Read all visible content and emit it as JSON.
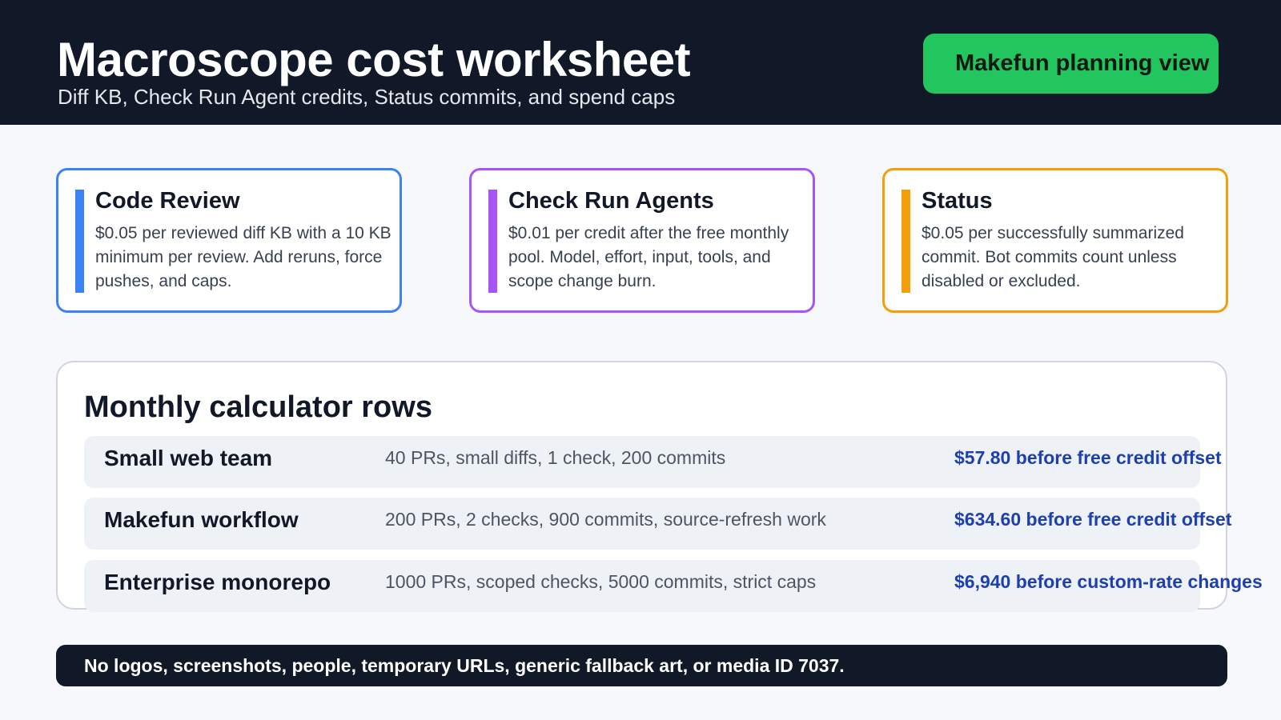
{
  "header": {
    "title": "Macroscope cost worksheet",
    "subtitle": "Diff KB, Check Run Agent credits, Status commits, and spend caps",
    "cta_label": "Makefun planning view"
  },
  "cards": [
    {
      "title": "Code Review",
      "body": "$0.05 per reviewed diff KB with a 10 KB minimum per review. Add reruns, force pushes, and caps.",
      "accent": "#3b82f6"
    },
    {
      "title": "Check Run Agents",
      "body": "$0.01 per credit after the free monthly pool. Model, effort, input, tools, and scope change burn.",
      "accent": "#a855f7"
    },
    {
      "title": "Status",
      "body": "$0.05 per successfully summarized commit. Bot commits count unless disabled or excluded.",
      "accent": "#f59e0b"
    }
  ],
  "calculator": {
    "title": "Monthly calculator rows",
    "rows": [
      {
        "name": "Small web team",
        "description": "40 PRs, small diffs, 1 check, 200 commits",
        "cost": "$57.80 before free credit offset"
      },
      {
        "name": "Makefun workflow",
        "description": "200 PRs, 2 checks, 900 commits, source-refresh work",
        "cost": "$634.60 before free credit offset"
      },
      {
        "name": "Enterprise monorepo",
        "description": "1000 PRs, scoped checks, 5000 commits, strict caps",
        "cost": "$6,940 before custom-rate changes"
      }
    ]
  },
  "footer": {
    "note": "No logos, screenshots, people, temporary URLs, generic fallback art, or media ID 7037."
  },
  "colors": {
    "header_bg": "#111827",
    "cta_bg": "#22c55e",
    "cost_text": "#1e40af",
    "page_bg": "#f6f8fc"
  }
}
